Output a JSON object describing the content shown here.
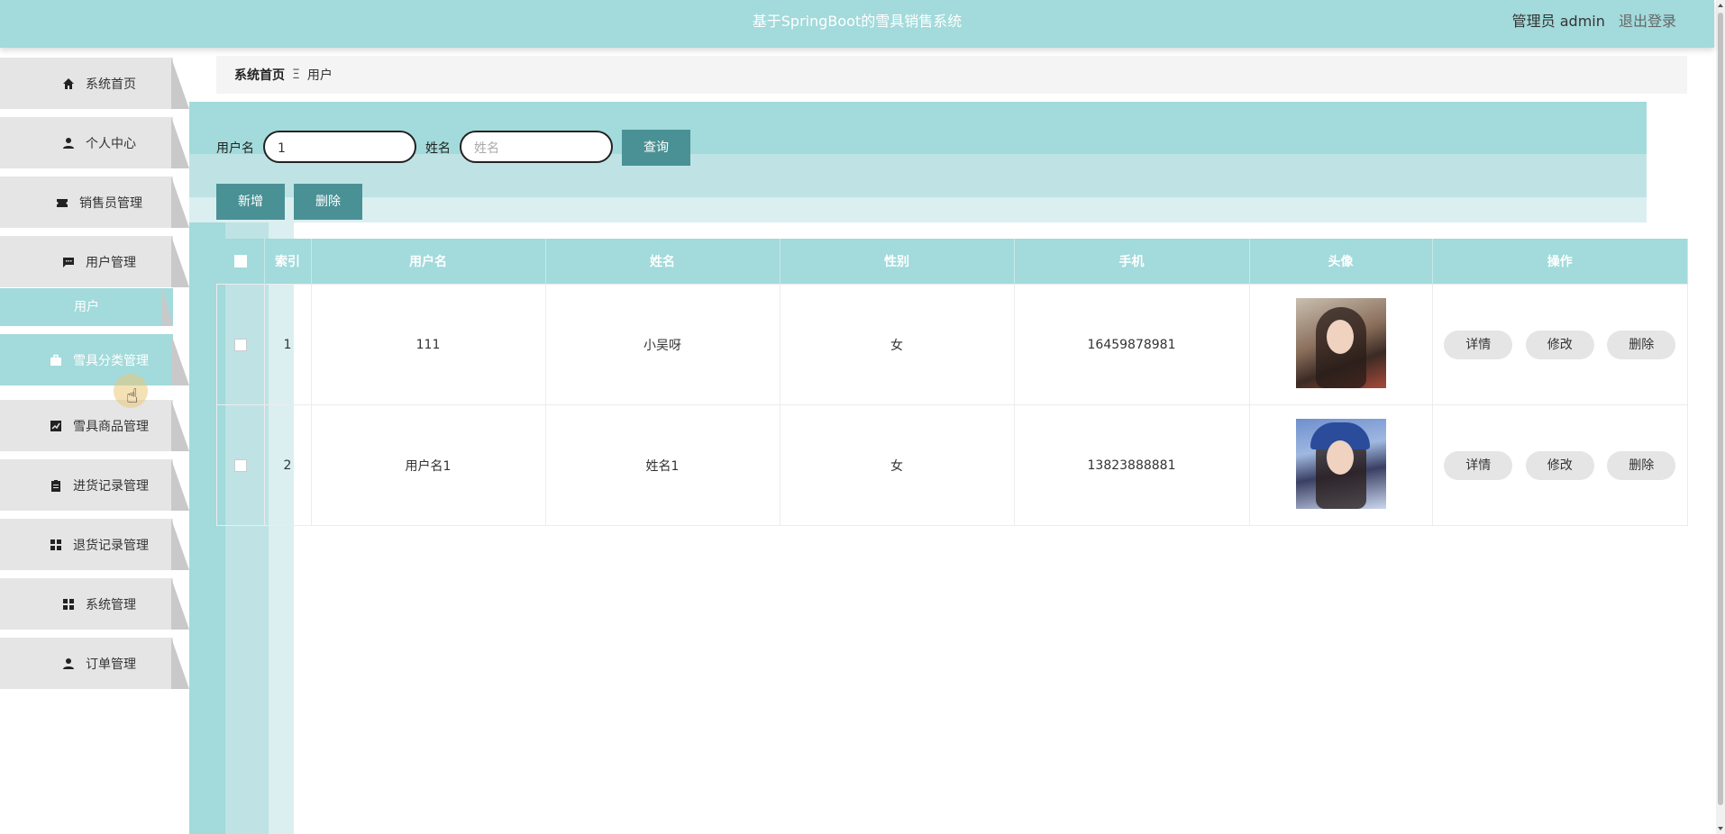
{
  "header": {
    "title": "基于SpringBoot的雪具销售系统",
    "user_label": "管理员 admin",
    "logout_label": "退出登录"
  },
  "sidebar": {
    "items": [
      {
        "label": "系统首页",
        "icon": "home-icon"
      },
      {
        "label": "个人中心",
        "icon": "person-icon"
      },
      {
        "label": "销售员管理",
        "icon": "ticket-icon"
      },
      {
        "label": "用户管理",
        "icon": "chat-icon"
      },
      {
        "label": "雪具分类管理",
        "icon": "briefcase-icon"
      },
      {
        "label": "雪具商品管理",
        "icon": "chart-icon"
      },
      {
        "label": "进货记录管理",
        "icon": "clipboard-icon"
      },
      {
        "label": "退货记录管理",
        "icon": "grid-icon"
      },
      {
        "label": "系统管理",
        "icon": "grid-icon"
      },
      {
        "label": "订单管理",
        "icon": "person-icon"
      }
    ],
    "submenu_user": "用户"
  },
  "breadcrumb": {
    "home": "系统首页",
    "separator": "Ξ",
    "current": "用户"
  },
  "search": {
    "username_label": "用户名",
    "username_value": "1",
    "name_label": "姓名",
    "name_placeholder": "姓名",
    "query_button": "查询",
    "add_button": "新增",
    "delete_button": "删除"
  },
  "table": {
    "headers": [
      "",
      "索引",
      "用户名",
      "姓名",
      "性别",
      "手机",
      "头像",
      "操作"
    ],
    "rows": [
      {
        "index": "1",
        "username": "111",
        "name": "小吴呀",
        "gender": "女",
        "phone": "16459878981"
      },
      {
        "index": "2",
        "username": "用户名1",
        "name": "姓名1",
        "gender": "女",
        "phone": "13823888881"
      }
    ],
    "actions": {
      "detail": "详情",
      "edit": "修改",
      "delete": "删除"
    }
  },
  "colors": {
    "accent": "#a3dadb",
    "button_dark": "#4a9195",
    "menu_bg": "#e5e5e5"
  }
}
